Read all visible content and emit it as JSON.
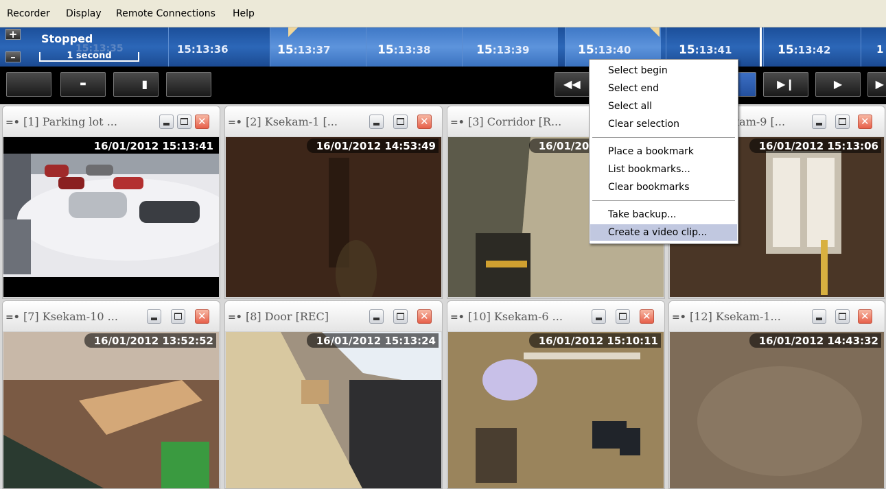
{
  "menu": [
    "Recorder",
    "Display",
    "Remote Connections",
    "Help"
  ],
  "timeline": {
    "status": "Stopped",
    "scale": "1 second",
    "zoom_in": "+",
    "zoom_out": "–",
    "ghost_label": "15:13:35",
    "cells": [
      {
        "pre": "",
        "bold": "",
        "main": "15:13:36"
      },
      {
        "pre": "",
        "bold": "15",
        "main": ":13:37"
      },
      {
        "pre": "",
        "bold": "15",
        "main": ":13:38"
      },
      {
        "pre": "",
        "bold": "15",
        "main": ":13:39"
      },
      {
        "pre": "",
        "bold": "15",
        "main": ":13:40"
      },
      {
        "pre": "",
        "bold": "15",
        "main": ":13:41"
      },
      {
        "pre": "",
        "bold": "15",
        "main": ":13:42"
      }
    ],
    "accent": "#2c67b8"
  },
  "cameras": [
    {
      "title": "[1] Parking lot ...",
      "timestamp": "16/01/2012 15:13:41"
    },
    {
      "title": "[2] Ksekam-1 [...",
      "timestamp": "16/01/2012 14:53:49"
    },
    {
      "title": "[3] Corridor [R...",
      "timestamp": "16/01/2012 15:13:41"
    },
    {
      "title": "[...] Ksekam-9 [...",
      "timestamp": "16/01/2012 15:13:06"
    },
    {
      "title": "[7] Ksekam-10 ...",
      "timestamp": "16/01/2012 13:52:52"
    },
    {
      "title": "[8] Door [REC]",
      "timestamp": "16/01/2012 15:13:24"
    },
    {
      "title": "[10] Ksekam-6 ...",
      "timestamp": "16/01/2012 15:10:11"
    },
    {
      "title": "[12] Ksekam-1...",
      "timestamp": "16/01/2012 14:43:32"
    }
  ],
  "context_menu": {
    "items": [
      "Select begin",
      "Select end",
      "Select all",
      "Clear selection",
      "Place a bookmark",
      "List bookmarks...",
      "Clear bookmarks",
      "Take backup...",
      "Create a video clip..."
    ],
    "highlighted": "Create a video clip..."
  }
}
